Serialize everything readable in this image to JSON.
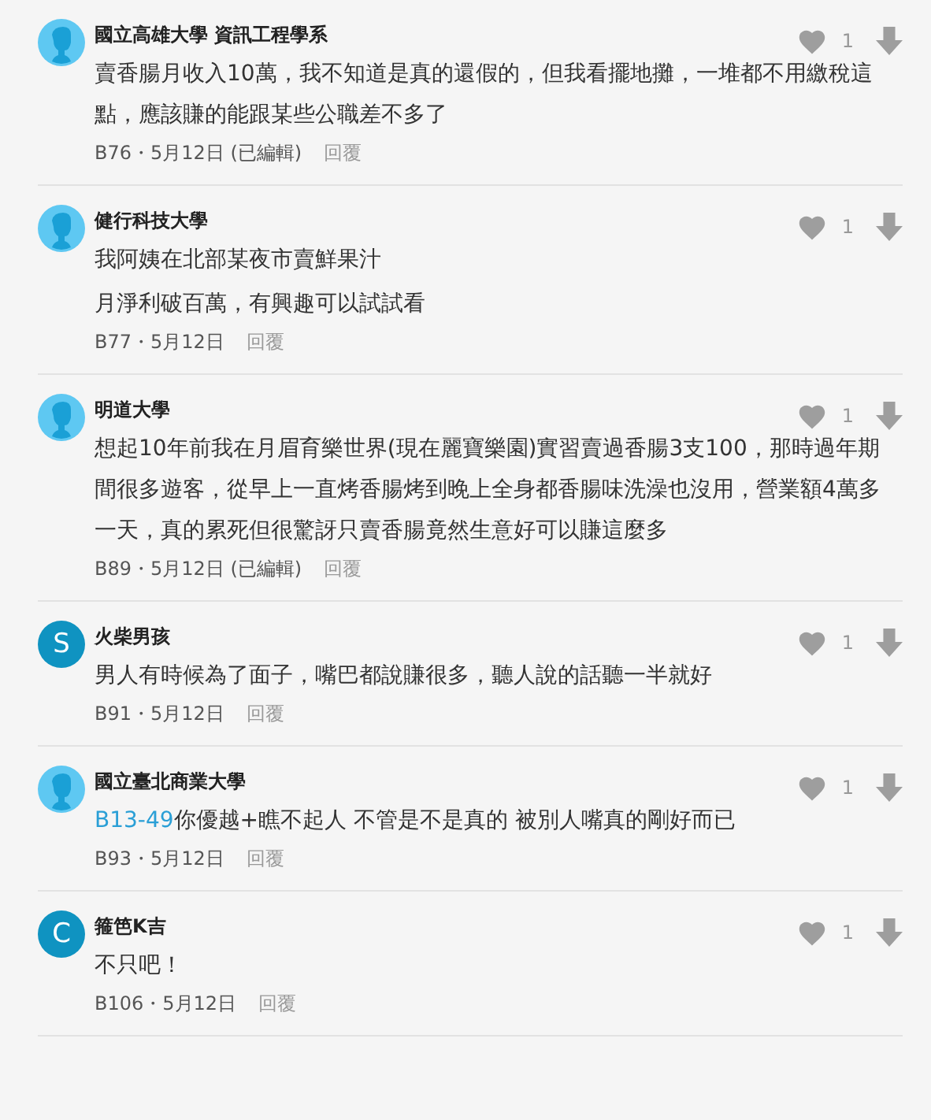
{
  "comments": [
    {
      "author": "國立高雄大學 資訊工程學系",
      "avatar": {
        "kind": "school"
      },
      "body": "賣香腸月收入10萬，我不知道是真的還假的，但我看擺地攤，一堆都不用繳稅這點，應該賺的能跟某些公職差不多了",
      "meta": "B76・5月12日 (已編輯)",
      "reply": "回覆",
      "likes": "1"
    },
    {
      "author": "健行科技大學",
      "avatar": {
        "kind": "school"
      },
      "body": "我阿姨在北部某夜市賣鮮果汁",
      "body2": "月淨利破百萬，有興趣可以試試看",
      "meta": "B77・5月12日",
      "reply": "回覆",
      "likes": "1"
    },
    {
      "author": "明道大學",
      "avatar": {
        "kind": "school"
      },
      "body": "想起10年前我在月眉育樂世界(現在麗寶樂園)實習賣過香腸3支100，那時過年期間很多遊客，從早上一直烤香腸烤到晚上全身都香腸味洗澡也沒用，營業額4萬多一天，真的累死但很驚訝只賣香腸竟然生意好可以賺這麼多",
      "meta": "B89・5月12日 (已編輯)",
      "reply": "回覆",
      "likes": "1"
    },
    {
      "author": "火柴男孩",
      "avatar": {
        "kind": "letter",
        "letter": "S",
        "color": "#0f93c1"
      },
      "body": "男人有時候為了面子，嘴巴都說賺很多，聽人說的話聽一半就好",
      "meta": "B91・5月12日",
      "reply": "回覆",
      "likes": "1"
    },
    {
      "author": "國立臺北商業大學",
      "avatar": {
        "kind": "school"
      },
      "mention": "B13-49",
      "body": "你優越+瞧不起人 不管是不是真的 被別人嘴真的剛好而已",
      "meta": "B93・5月12日",
      "reply": "回覆",
      "likes": "1"
    },
    {
      "author": "箍笆K吉",
      "avatar": {
        "kind": "letter",
        "letter": "C",
        "color": "#0f93c1"
      },
      "body": "不只吧！",
      "meta": "B106・5月12日",
      "reply": "回覆",
      "likes": "1"
    }
  ]
}
